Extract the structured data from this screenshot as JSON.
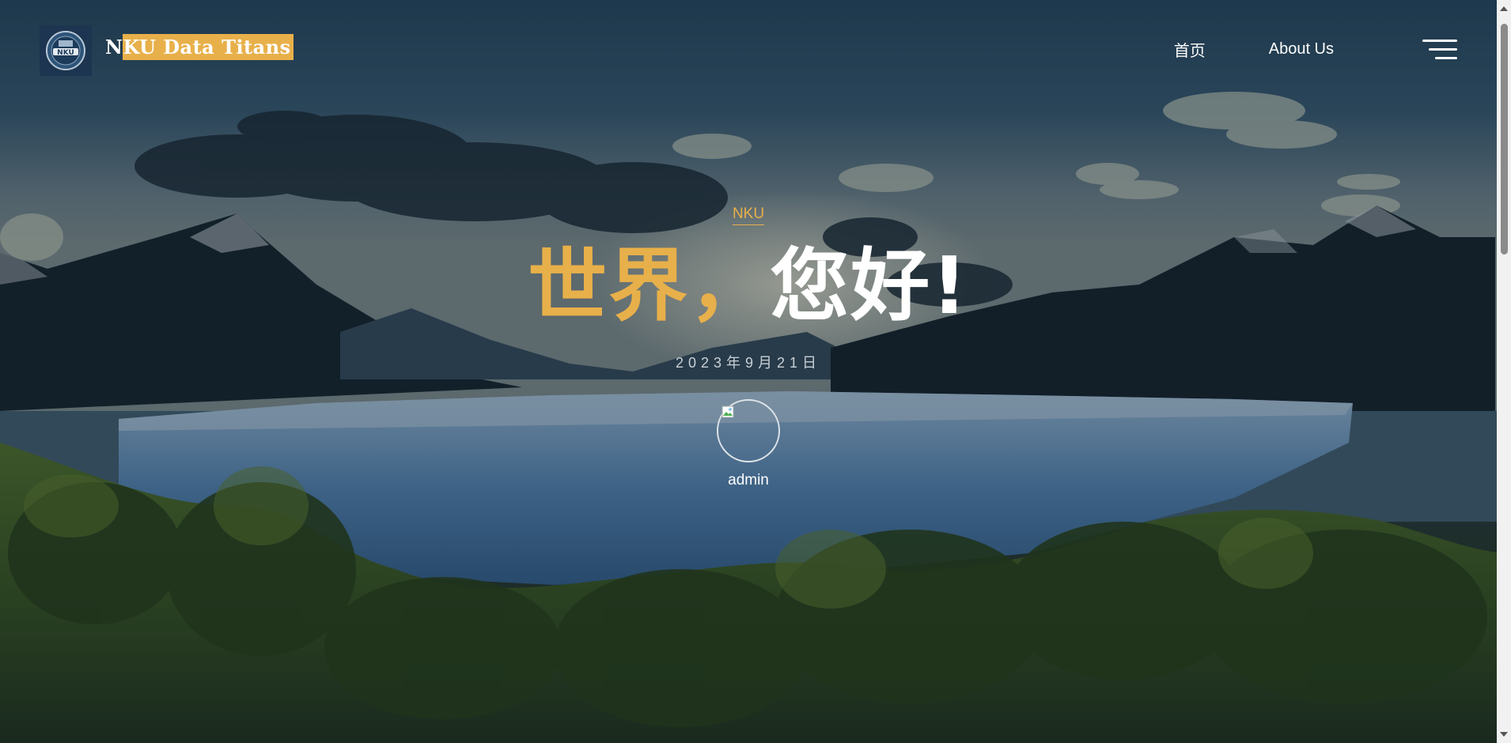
{
  "brand": {
    "logo_icon": "nku-logo-icon",
    "name_prefix": "N",
    "name_highlight": "KU Data Titans"
  },
  "nav": {
    "items": [
      {
        "label": "首页"
      },
      {
        "label": "About Us"
      }
    ],
    "menu_icon": "hamburger-menu-icon"
  },
  "hero": {
    "tag": "NKU",
    "title_highlight": "世界，",
    "title_rest": "您好!",
    "date": "2023年9月21日",
    "author": "admin",
    "avatar_icon": "broken-image-icon"
  },
  "colors": {
    "accent": "#e8b04a",
    "text": "#ffffff",
    "date_text": "#c8d0d6"
  }
}
